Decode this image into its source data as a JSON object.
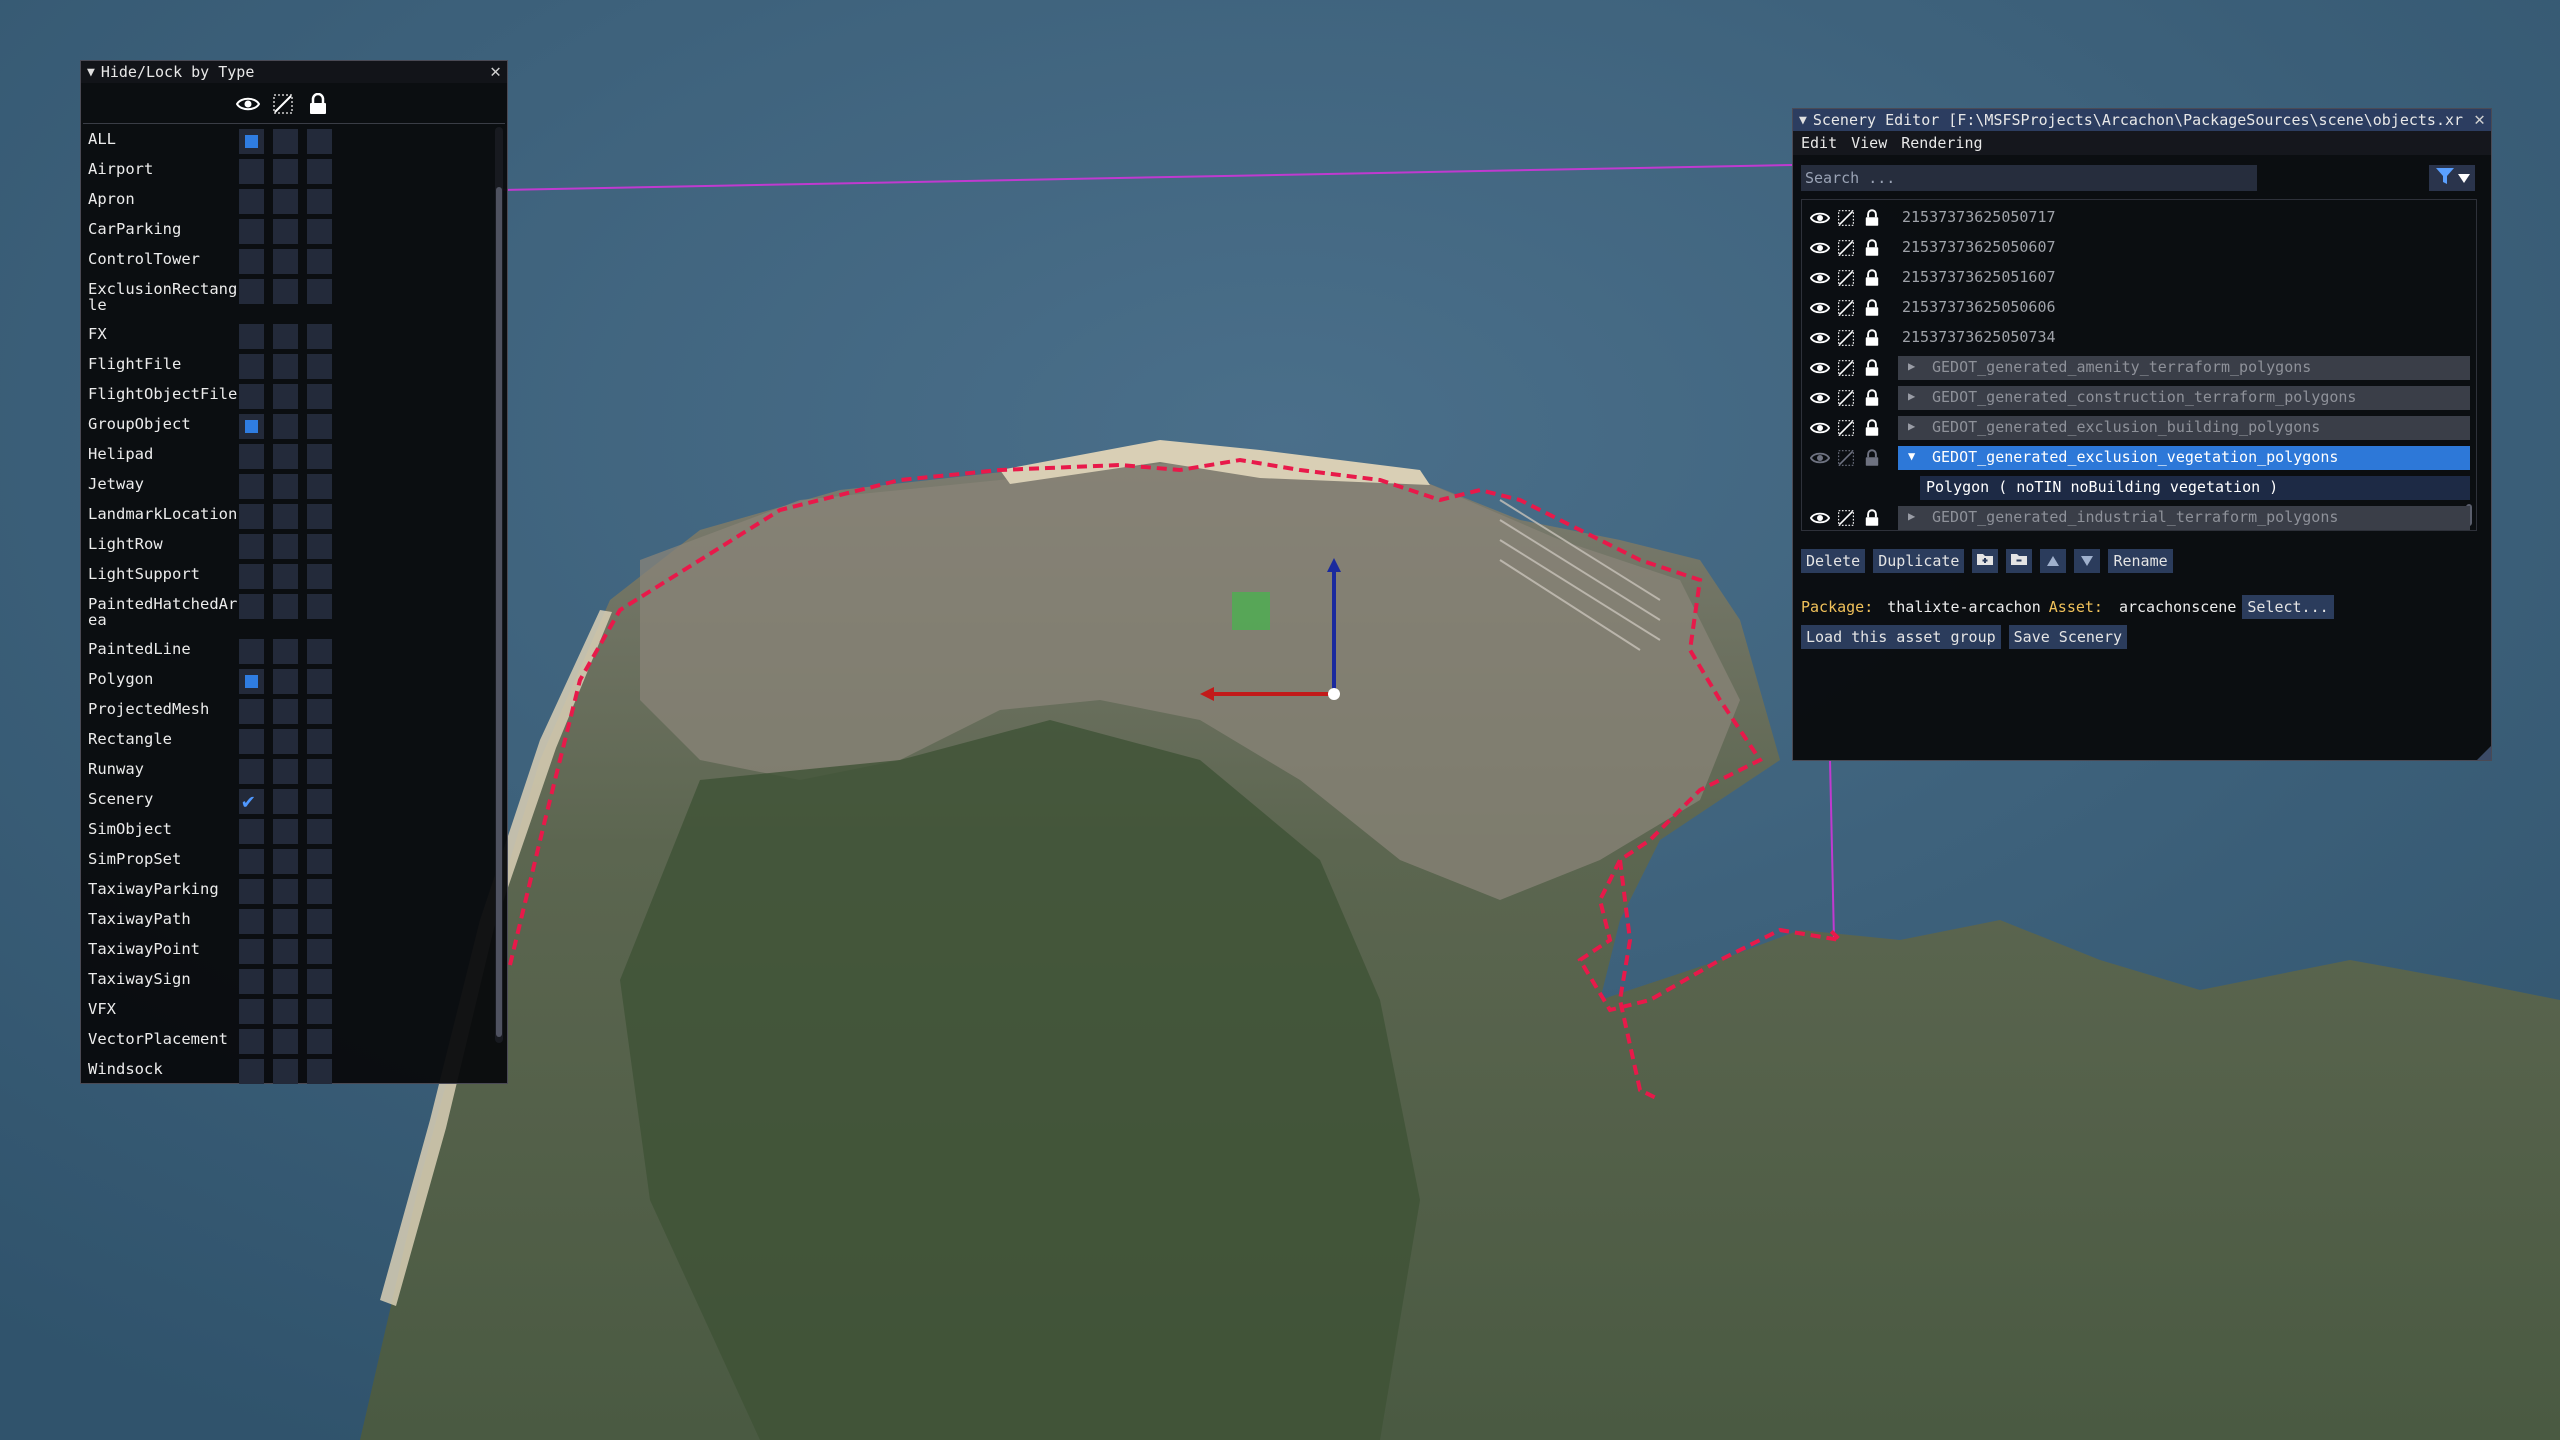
{
  "hide_lock": {
    "title": "Hide/Lock by Type",
    "column_icons": [
      "eye-icon",
      "pencil-slash-icon",
      "lock-icon"
    ],
    "types": [
      {
        "label": "ALL",
        "visible_state": "partial"
      },
      {
        "label": "Airport",
        "visible_state": "off"
      },
      {
        "label": "Apron",
        "visible_state": "off"
      },
      {
        "label": "CarParking",
        "visible_state": "off"
      },
      {
        "label": "ControlTower",
        "visible_state": "off"
      },
      {
        "label": "ExclusionRectangle",
        "visible_state": "off",
        "tall": true
      },
      {
        "label": "FX",
        "visible_state": "off"
      },
      {
        "label": "FlightFile",
        "visible_state": "off"
      },
      {
        "label": "FlightObjectFile",
        "visible_state": "off"
      },
      {
        "label": "GroupObject",
        "visible_state": "partial"
      },
      {
        "label": "Helipad",
        "visible_state": "off"
      },
      {
        "label": "Jetway",
        "visible_state": "off"
      },
      {
        "label": "LandmarkLocation",
        "visible_state": "off"
      },
      {
        "label": "LightRow",
        "visible_state": "off"
      },
      {
        "label": "LightSupport",
        "visible_state": "off"
      },
      {
        "label": "PaintedHatchedArea",
        "visible_state": "off",
        "tall": true
      },
      {
        "label": "PaintedLine",
        "visible_state": "off"
      },
      {
        "label": "Polygon",
        "visible_state": "partial"
      },
      {
        "label": "ProjectedMesh",
        "visible_state": "off"
      },
      {
        "label": "Rectangle",
        "visible_state": "off"
      },
      {
        "label": "Runway",
        "visible_state": "off"
      },
      {
        "label": "Scenery",
        "visible_state": "checked"
      },
      {
        "label": "SimObject",
        "visible_state": "off"
      },
      {
        "label": "SimPropSet",
        "visible_state": "off"
      },
      {
        "label": "TaxiwayParking",
        "visible_state": "off"
      },
      {
        "label": "TaxiwayPath",
        "visible_state": "off"
      },
      {
        "label": "TaxiwayPoint",
        "visible_state": "off"
      },
      {
        "label": "TaxiwaySign",
        "visible_state": "off"
      },
      {
        "label": "VFX",
        "visible_state": "off"
      },
      {
        "label": "VectorPlacement",
        "visible_state": "off"
      },
      {
        "label": "Windsock",
        "visible_state": "off"
      }
    ]
  },
  "scenery_editor": {
    "title": "Scenery Editor [F:\\MSFSProjects\\Arcachon\\PackageSources\\scene\\objects.xr",
    "menu": [
      "Edit",
      "View",
      "Rendering"
    ],
    "search_placeholder": "Search ...",
    "objects": [
      {
        "kind": "item",
        "label": "21537373625050717"
      },
      {
        "kind": "item",
        "label": "21537373625050607"
      },
      {
        "kind": "item",
        "label": "21537373625051607"
      },
      {
        "kind": "item",
        "label": "21537373625050606"
      },
      {
        "kind": "item",
        "label": "21537373625050734"
      },
      {
        "kind": "group",
        "label": "GEDOT_generated_amenity_terraform_polygons"
      },
      {
        "kind": "group",
        "label": "GEDOT_generated_construction_terraform_polygons"
      },
      {
        "kind": "group",
        "label": "GEDOT_generated_exclusion_building_polygons"
      },
      {
        "kind": "group-selected",
        "label": "GEDOT_generated_exclusion_vegetation_polygons"
      },
      {
        "kind": "child",
        "label": "Polygon  ( noTIN noBuilding vegetation )"
      },
      {
        "kind": "group",
        "label": "GEDOT_generated_industrial_terraform_polygons"
      }
    ],
    "buttons": {
      "delete": "Delete",
      "duplicate": "Duplicate",
      "rename": "Rename",
      "select": "Select...",
      "load_group": "Load this asset group",
      "save": "Save Scenery"
    },
    "package_label": "Package:",
    "package_value": "thalixte-arcachon",
    "asset_label": "Asset:",
    "asset_value": "arcachonscene"
  },
  "colors": {
    "accent": "#2d78d8",
    "polygon_outline": "#e8194a",
    "water": "#3c607a",
    "land": "#56624c"
  }
}
